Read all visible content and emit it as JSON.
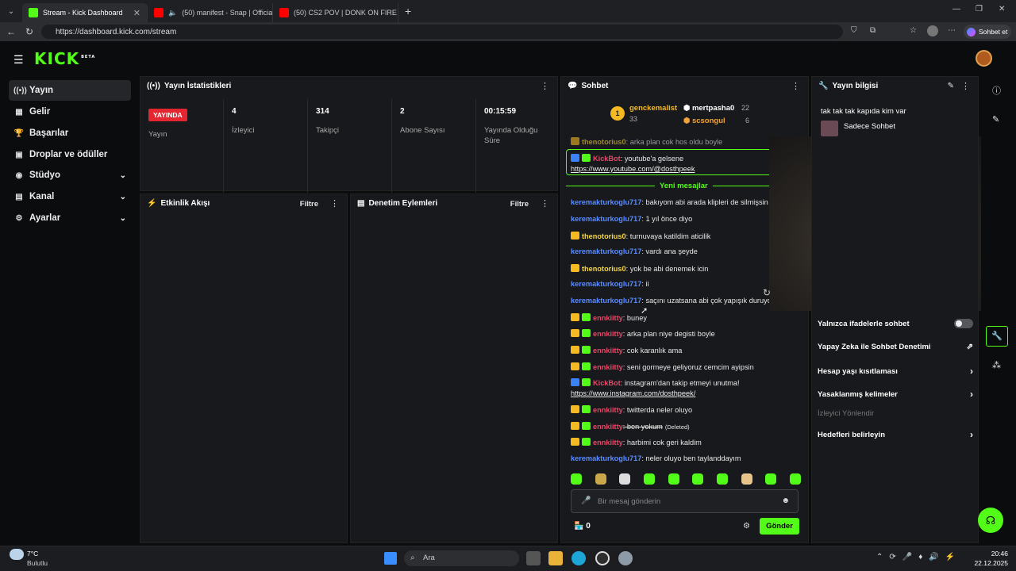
{
  "browser": {
    "tabs": [
      {
        "title": "Stream - Kick Dashboard",
        "active": true
      },
      {
        "title": "(50) manifest - Snap | Official"
      },
      {
        "title": "(50) CS2 POV | DONK ON FIRE🔥"
      }
    ],
    "url": "https://dashboard.kick.com/stream",
    "copilot_label": "Sohbet et"
  },
  "app": {
    "logo": "KICK",
    "logo_badge": "BETA",
    "nav": [
      {
        "label": "Yayın",
        "icon": "broadcast-icon"
      },
      {
        "label": "Gelir",
        "icon": "revenue-icon"
      },
      {
        "label": "Başarılar",
        "icon": "trophy-icon"
      },
      {
        "label": "Droplar ve ödüller",
        "icon": "drops-icon"
      },
      {
        "label": "Stüdyo",
        "icon": "studio-icon"
      },
      {
        "label": "Kanal",
        "icon": "channel-icon"
      },
      {
        "label": "Ayarlar",
        "icon": "settings-icon"
      }
    ]
  },
  "stats": {
    "title": "Yayın İstatistikleri",
    "live_badge": "YAYINDA",
    "live_label": "Yayın",
    "items": [
      {
        "value": "4",
        "label": "İzleyici"
      },
      {
        "value": "314",
        "label": "Takipçi"
      },
      {
        "value": "2",
        "label": "Abone Sayısı"
      },
      {
        "value": "00:15:59",
        "label": "Yayında Olduğu Süre"
      }
    ]
  },
  "activity": {
    "title": "Etkinlik Akışı",
    "filter": "Filtre"
  },
  "moderation": {
    "title": "Denetim Eylemleri",
    "filter": "Filtre"
  },
  "chat": {
    "title": "Sohbet",
    "leaders": [
      {
        "rank": "1",
        "name": "genckemalist",
        "count": "33"
      },
      {
        "name": "mertpasha0",
        "count": "22"
      },
      {
        "name": "scsongul",
        "count": "6"
      }
    ],
    "top_partial": {
      "user": "thenotorius0",
      "text": ": arka plan cok hos oldu boyle"
    },
    "pinned": {
      "user": "KickBot",
      "text": ": youtube'a gelsene",
      "link": "https://www.youtube.com/@dosthpeek"
    },
    "new_messages": "Yeni mesajlar",
    "messages": [
      {
        "user": "keremakturkoglu717",
        "text": ": bakıyom abi arada klipleri de silmişsin",
        "color": "blue"
      },
      {
        "user": "keremakturkoglu717",
        "text": ": 1 yıl önce diyo",
        "color": "blue"
      },
      {
        "user": "thenotorius0",
        "text": ": turnuvaya katildim aticilik",
        "color": "yel"
      },
      {
        "user": "keremakturkoglu717",
        "text": ": vardı ana şeyde",
        "color": "blue"
      },
      {
        "user": "thenotorius0",
        "text": ": yok be abi denemek icin",
        "color": "yel"
      },
      {
        "user": "keremakturkoglu717",
        "text": ": ii",
        "color": "blue"
      },
      {
        "user": "keremakturkoglu717",
        "text": ": saçını uzatsana abi çok yapışık duruyo",
        "color": "blue"
      },
      {
        "user": "ennkiitty",
        "text": ": buney",
        "color": "pink"
      },
      {
        "user": "ennkiitty",
        "text": ": arka plan niye degisti boyle",
        "color": "pink"
      },
      {
        "user": "ennkiitty",
        "text": ": cok karanlık ama",
        "color": "pink"
      },
      {
        "user": "ennkiitty",
        "text": ": seni gormeye geliyoruz cemcim ayipsin",
        "color": "pink"
      }
    ],
    "kickbot2": {
      "user": "KickBot",
      "text": ": instagram'dan takip etmeyi unutma!",
      "link": "https://www.instagram.com/dosthpeek/"
    },
    "messages2": [
      {
        "user": "ennkiitty",
        "text": ": twitterda neler oluyo",
        "color": "pink"
      },
      {
        "user": "ennkiitty",
        "text": ": ben yokum",
        "deleted": "(Deleted)",
        "color": "pink"
      },
      {
        "user": "ennkiitty",
        "text": ": harbimi cok geri kaldim",
        "color": "pink"
      },
      {
        "user": "keremakturkoglu717",
        "text": ": neler oluyo ben taylanddayım",
        "color": "blue"
      }
    ],
    "input_placeholder": "Bir mesaj gönderin",
    "points": "0",
    "send": "Gönder"
  },
  "stream_info": {
    "title": "Yayın bilgisi",
    "stream_title": "tak tak tak kapıda kim var",
    "category": "Sadece Sohbet",
    "rows": [
      {
        "label": "Yalnızca ifadelerle sohbet",
        "kind": "toggle"
      },
      {
        "label": "Yapay Zeka ile Sohbet Denetimi",
        "kind": "external"
      },
      {
        "label": "Hesap yaşı kısıtlaması",
        "kind": "arrow"
      },
      {
        "label": "Yasaklanmış kelimeler",
        "kind": "arrow"
      },
      {
        "label": "İzleyici Yönlendir",
        "kind": "disabled"
      },
      {
        "label": "Hedefleri belirleyin",
        "kind": "arrow"
      }
    ]
  },
  "taskbar": {
    "weather_temp": "7°C",
    "weather_desc": "Bulutlu",
    "search": "Ara",
    "time": "20:46",
    "date": "22.12.2025"
  }
}
